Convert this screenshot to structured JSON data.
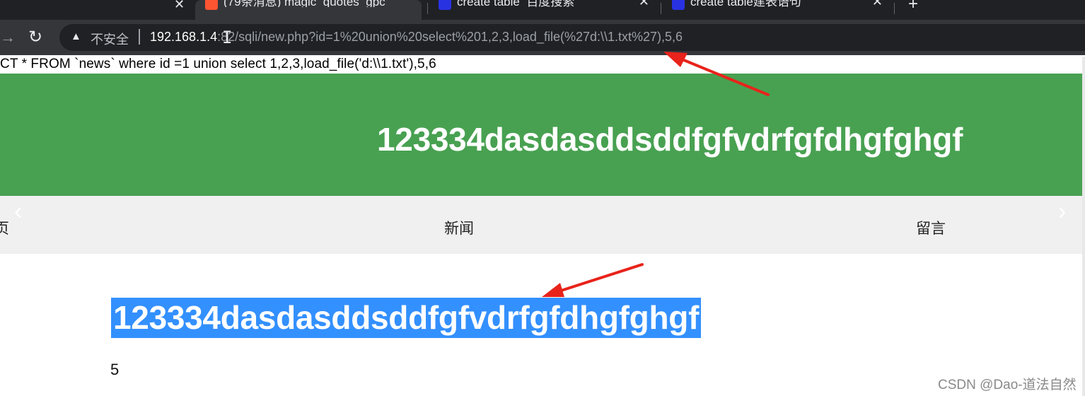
{
  "tabs": [
    {
      "title": "(79条消息) magic_quotes_gpc",
      "favicon_color": "#fc5531"
    },
    {
      "title": "create table_百度搜索",
      "favicon_color": "#2932e1"
    },
    {
      "title": "create table建表语句",
      "favicon_color": "#2932e1"
    }
  ],
  "new_tab_label": "+",
  "close_glyph": "✕",
  "toolbar": {
    "security_label": "不安全",
    "url_host": "192.168.1.4",
    "url_rest": ":82/sqli/new.php?id=1%20union%20select%201,2,3,load_file(%27d:\\\\1.txt%27),5,6"
  },
  "page": {
    "sql_query": "CT * FROM `news` where id =1 union select 1,2,3,load_file('d:\\\\1.txt'),5,6",
    "banner_title": "123334dasdasddsddfgfvdrfgfdhgfghgf",
    "nav": [
      "页",
      "新闻",
      "留言"
    ],
    "headline": "123334dasdasddsddfgfvdrfgfdhgfghgf",
    "field_value": "5"
  },
  "watermark": "CSDN @Dao-道法自然",
  "colors": {
    "banner_green": "#48a151",
    "selection_blue": "#3390ff",
    "annotation_red": "#e8231b"
  }
}
